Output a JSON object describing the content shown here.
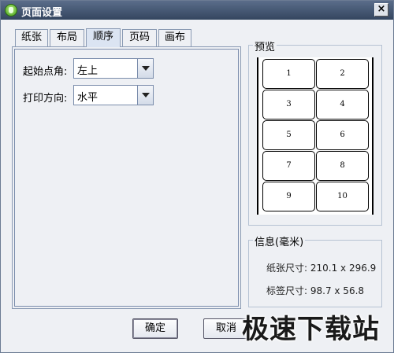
{
  "window": {
    "title": "页面设置",
    "close_glyph": "×"
  },
  "tabs": [
    {
      "label": "纸张"
    },
    {
      "label": "布局"
    },
    {
      "label": "顺序",
      "active": true
    },
    {
      "label": "页码"
    },
    {
      "label": "画布"
    }
  ],
  "order": {
    "start_corner_label": "起始点角:",
    "start_corner_value": "左上",
    "print_direction_label": "打印方向:",
    "print_direction_value": "水平"
  },
  "preview": {
    "title": "预览",
    "cells": [
      "1",
      "2",
      "3",
      "4",
      "5",
      "6",
      "7",
      "8",
      "9",
      "10"
    ]
  },
  "info": {
    "title": "信息(毫米)",
    "paper_size": "纸张尺寸: 210.1 x 296.9",
    "label_size": "标签尺寸: 98.7 x 56.8"
  },
  "buttons": {
    "ok": "确定",
    "cancel": "取消"
  },
  "watermark": "极速下载站"
}
